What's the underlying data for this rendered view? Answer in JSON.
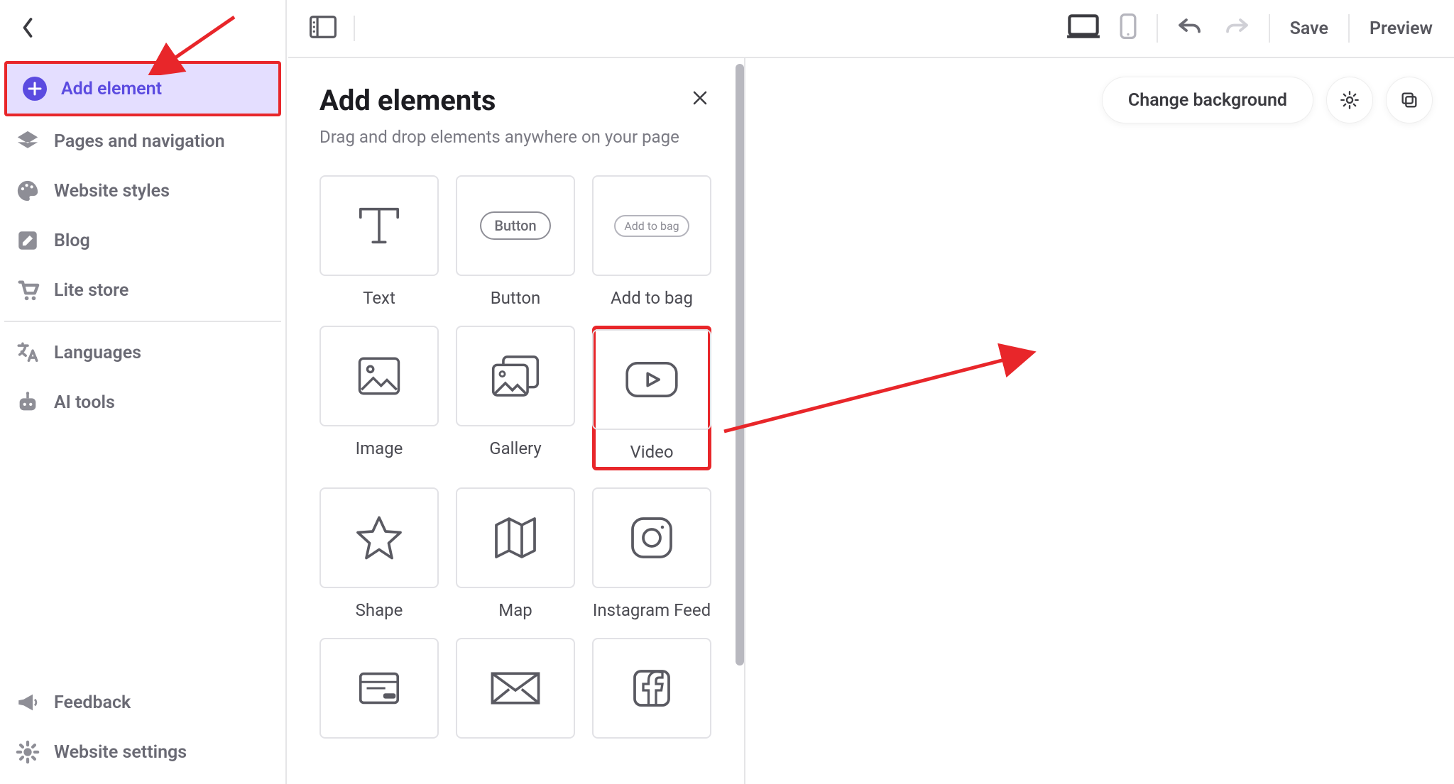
{
  "sidebar": {
    "items": [
      {
        "label": "Add element"
      },
      {
        "label": "Pages and navigation"
      },
      {
        "label": "Website styles"
      },
      {
        "label": "Blog"
      },
      {
        "label": "Lite store"
      },
      {
        "label": "Languages"
      },
      {
        "label": "AI tools"
      }
    ],
    "bottom": [
      {
        "label": "Feedback"
      },
      {
        "label": "Website settings"
      }
    ]
  },
  "topbar": {
    "save": "Save",
    "preview": "Preview"
  },
  "panel": {
    "title": "Add elements",
    "subtitle": "Drag and drop elements anywhere on your page",
    "tiles": [
      {
        "label": "Text"
      },
      {
        "label": "Button",
        "sample": "Button"
      },
      {
        "label": "Add to bag",
        "sample": "Add to bag"
      },
      {
        "label": "Image"
      },
      {
        "label": "Gallery"
      },
      {
        "label": "Video"
      },
      {
        "label": "Shape"
      },
      {
        "label": "Map"
      },
      {
        "label": "Instagram Feed"
      },
      {
        "label": ""
      },
      {
        "label": ""
      },
      {
        "label": ""
      }
    ]
  },
  "canvas": {
    "change_bg": "Change background"
  }
}
